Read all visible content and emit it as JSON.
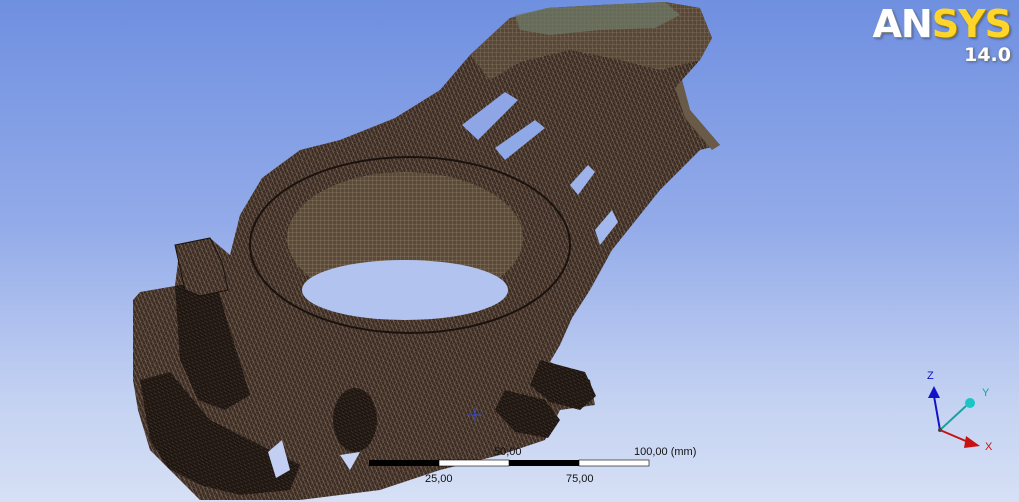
{
  "logo": {
    "brand_an": "AN",
    "brand_sys": "SYS",
    "version": "14.0"
  },
  "scale_bar": {
    "labels_top": [
      "50,00",
      "100,00 (mm)"
    ],
    "labels_bottom": [
      "25,00",
      "75,00"
    ]
  },
  "triad": {
    "z_label": "Z",
    "y_label": "Y",
    "x_label": "X",
    "z_color": "#1212c8",
    "y_color": "#16a3a3",
    "x_color": "#c81212"
  },
  "colors": {
    "background_top": "#6f8fe0",
    "background_bottom": "#d6e0f5",
    "mesh_fill": "#3a2a22",
    "mesh_line": "#9c8a73"
  }
}
